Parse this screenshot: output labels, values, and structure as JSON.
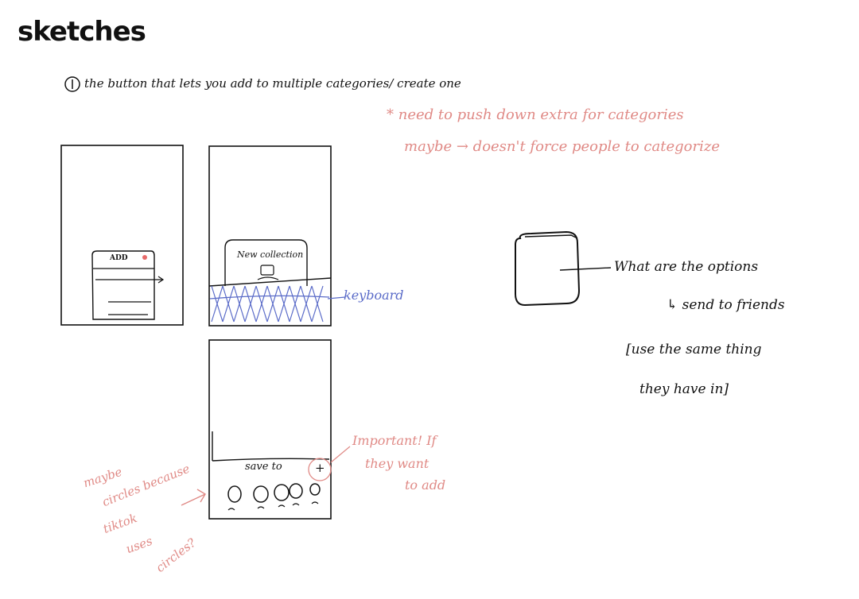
{
  "title": "sketches",
  "item1": {
    "number": "1",
    "text": "the button that lets you add to multiple categories/ create one"
  },
  "notes": {
    "line1": "* need to push down extra for categories",
    "line2": "maybe → doesn't force people to categorize"
  },
  "frame1": {
    "label": "ADD"
  },
  "frame2": {
    "label": "New collection",
    "annotation": "keyboard"
  },
  "frame3": {
    "label": "save to",
    "plus": "+"
  },
  "important": {
    "line1": "Important! If",
    "line2": "they want",
    "line3": "to add"
  },
  "maybe_note": {
    "line1": "maybe",
    "line2": "circles because",
    "line3": "tiktok",
    "line4": "uses",
    "line5": "circles?"
  },
  "options": {
    "line1": "What are the options",
    "line2": "↳ send to friends",
    "line3": "[use the same thing",
    "line4": "they have in]"
  },
  "colors": {
    "ink": "#111111",
    "pink": "#e08a86",
    "blue": "#5a6bc8"
  }
}
